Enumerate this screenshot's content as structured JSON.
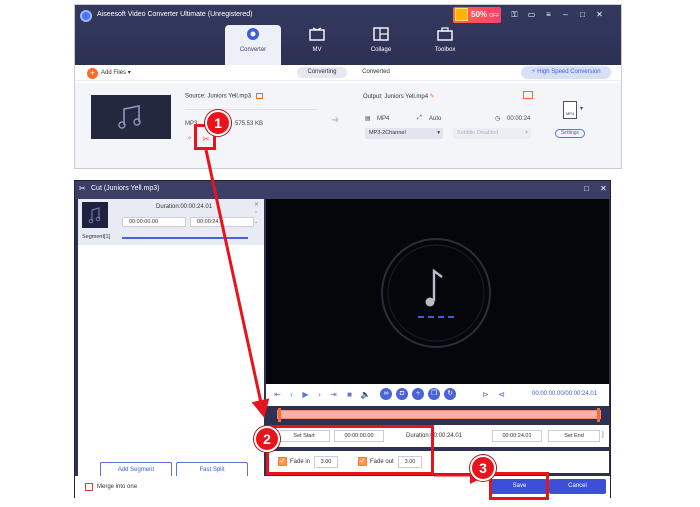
{
  "app": {
    "title": "Aiseesoft Video Converter Ultimate (Unregistered)",
    "promo": "50%",
    "promo_off": "OFF"
  },
  "nav": {
    "tabs": [
      {
        "label": "Converter"
      },
      {
        "label": "MV"
      },
      {
        "label": "Collage"
      },
      {
        "label": "Toolbox"
      }
    ]
  },
  "toolbar": {
    "add_files": "Add Files",
    "converting": "Converting",
    "converted": "Converted",
    "high_speed": "High Speed Conversion"
  },
  "file": {
    "source": "Source: Juniors Yell.mp3",
    "format": "MP3",
    "size": "575.53 KB",
    "output": "Output: Juniors Yell.mp4",
    "out_format": "MP4",
    "out_res": "Auto",
    "out_duration": "00:00:24",
    "audio_track": "MP3-2Channel",
    "subtitle": "Subtitle Disabled",
    "settings": "Settings",
    "format_badge": "MP4"
  },
  "cut": {
    "title": "Cut (Juniors Yell.mp3)",
    "duration_label": "Duration:00:00:24.01",
    "seg_start": "00:00:00.00",
    "seg_end": "00:00:24.0",
    "segment_label": "Segment[1]",
    "add_segment": "Add Segment",
    "fast_split": "Fast Split",
    "time_display": "00:00:00.00/00:00:24.01",
    "set_start": "Set Start",
    "start_time": "00:00:00.00",
    "duration_center": "Duration:00:00:24.01",
    "end_time": "00:00:24.01",
    "set_end": "Set End",
    "fade_in_label": "Fade in",
    "fade_in_value": "3.00",
    "fade_out_label": "Fade out",
    "fade_out_value": "3.00",
    "merge": "Merge into one",
    "save": "Save",
    "cancel": "Cancel"
  },
  "annotations": {
    "badge1": "1",
    "badge2": "2",
    "badge3": "3",
    "accent": "#e8141c"
  },
  "colors": {
    "titlebar": "#34395e",
    "accent_blue": "#3b4fd8",
    "accent_orange": "#ff6a2a"
  }
}
